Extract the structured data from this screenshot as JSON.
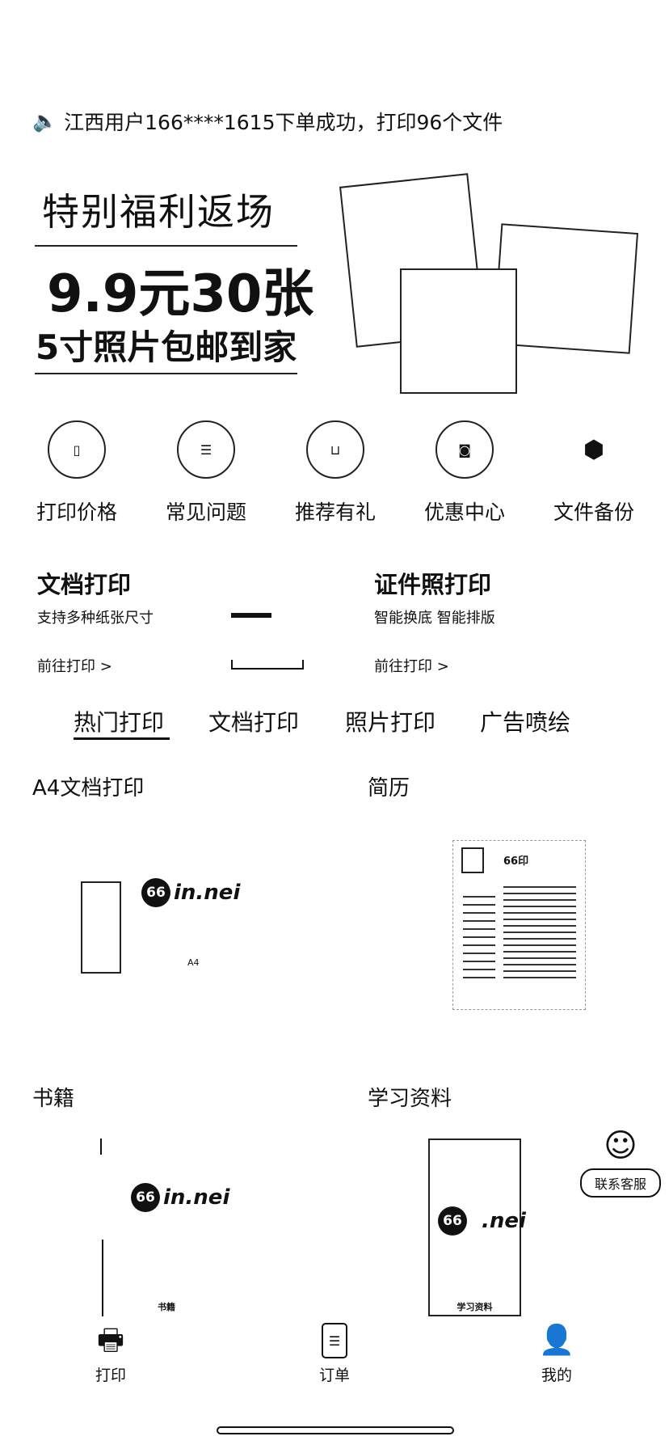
{
  "notice": {
    "icon": "speaker-icon",
    "text": "江西用户166****1615下单成功，打印96个文件"
  },
  "banner": {
    "line1": "特别福利返场",
    "line2": "9.9元30张",
    "line3": "5寸照片包邮到家"
  },
  "shortcuts": [
    {
      "label": "打印价格",
      "icon": "price-icon"
    },
    {
      "label": "常见问题",
      "icon": "faq-icon"
    },
    {
      "label": "推荐有礼",
      "icon": "gift-icon"
    },
    {
      "label": "优惠中心",
      "icon": "coupon-icon"
    },
    {
      "label": "文件备份",
      "icon": "backup-icon"
    }
  ],
  "cards": [
    {
      "title": "文档打印",
      "subtitle": "支持多种纸张尺寸",
      "link": "前往打印 >"
    },
    {
      "title": "证件照打印",
      "subtitle": "智能换底 智能排版",
      "link": "前往打印 >"
    }
  ],
  "tabs": [
    "热门打印",
    "文档打印",
    "照片打印",
    "广告喷绘"
  ],
  "products": [
    {
      "title": "A4文档打印",
      "logo_num": "66",
      "logo_text": "in.nei",
      "caption": "A4"
    },
    {
      "title": "简历",
      "resume_title": "66印"
    },
    {
      "title": "书籍",
      "logo_num": "66",
      "logo_text": "in.nei",
      "caption": "书籍"
    },
    {
      "title": "学习资料",
      "logo_num": "66",
      "logo_text": ".nei",
      "caption": "学习资料"
    }
  ],
  "float_service": {
    "label": "联系客服"
  },
  "bottom_nav": [
    {
      "label": "打印",
      "icon": "printer-icon"
    },
    {
      "label": "订单",
      "icon": "order-icon"
    },
    {
      "label": "我的",
      "icon": "user-icon"
    }
  ]
}
